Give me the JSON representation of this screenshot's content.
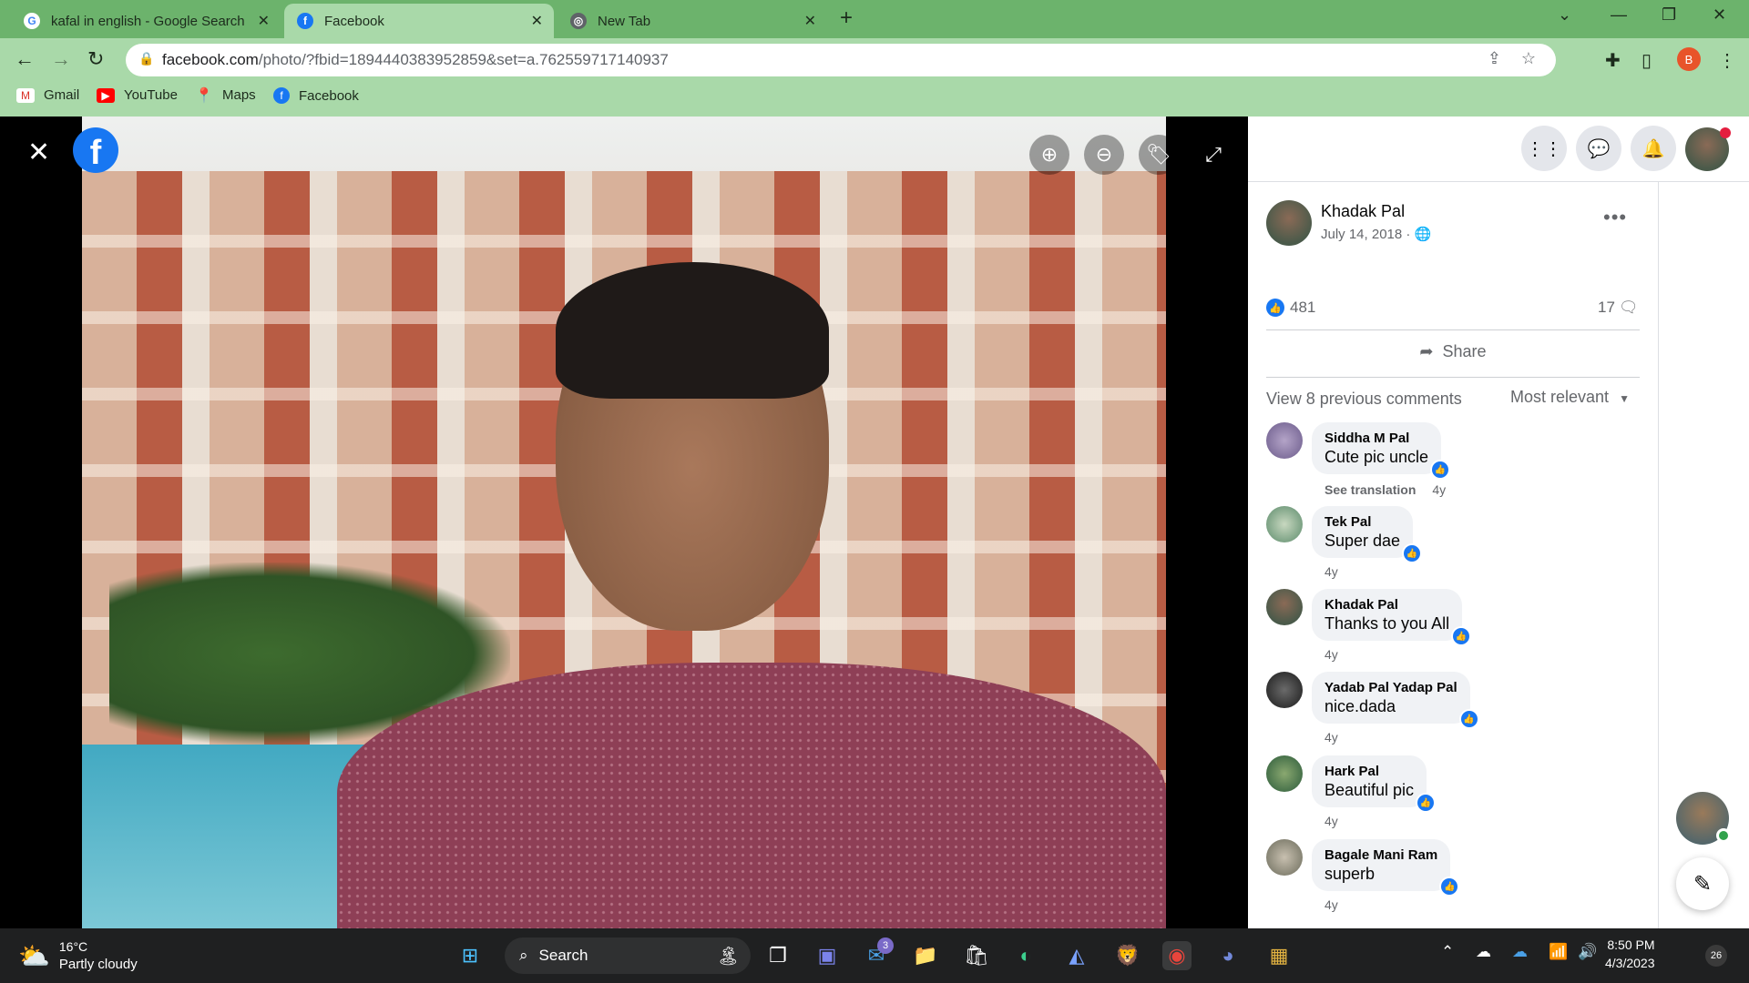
{
  "browser": {
    "tabs": [
      {
        "title": "kafal in english - Google Search",
        "icon": "google-icon"
      },
      {
        "title": "Facebook",
        "icon": "facebook-icon",
        "active": true
      },
      {
        "title": "New Tab",
        "icon": "chrome-icon"
      }
    ],
    "url_host": "facebook.com",
    "url_path": "/photo/?fbid=1894440383952859&set=a.762559717140937",
    "profile_initial": "B",
    "bookmarks": [
      {
        "label": "Gmail",
        "icon": "gmail-icon"
      },
      {
        "label": "YouTube",
        "icon": "youtube-icon"
      },
      {
        "label": "Maps",
        "icon": "maps-icon"
      },
      {
        "label": "Facebook",
        "icon": "facebook-icon"
      }
    ],
    "accent": "#6cb36c"
  },
  "viewer": {
    "logo": "f",
    "tools": [
      "zoom-in-icon",
      "zoom-out-icon",
      "tag-icon",
      "fullscreen-icon"
    ]
  },
  "post": {
    "author": "Khadak Pal",
    "date": "July 14, 2018 ·",
    "likes": "481",
    "comments_count": "17",
    "share_label": "Share",
    "view_previous": "View 8 previous comments",
    "sort_label": "Most relevant",
    "comments": [
      {
        "name": "Siddha M Pal",
        "text": "Cute pic uncle",
        "see_translation": "See translation",
        "age": "4y"
      },
      {
        "name": "Tek Pal",
        "text": "Super dae",
        "age": "4y"
      },
      {
        "name": "Khadak Pal",
        "text": "Thanks to you All",
        "age": "4y"
      },
      {
        "name": "Yadab Pal Yadap Pal",
        "text": "nice.dada",
        "age": "4y"
      },
      {
        "name": "Hark Pal",
        "text": "Beautiful pic",
        "age": "4y"
      },
      {
        "name": "Bagale Mani Ram",
        "text": "superb",
        "age": "4y"
      }
    ]
  },
  "taskbar": {
    "temperature": "16°C",
    "condition": "Partly cloudy",
    "search_label": "Search",
    "mail_badge": "3",
    "time": "8:50 PM",
    "date": "4/3/2023",
    "notifications": "26"
  }
}
